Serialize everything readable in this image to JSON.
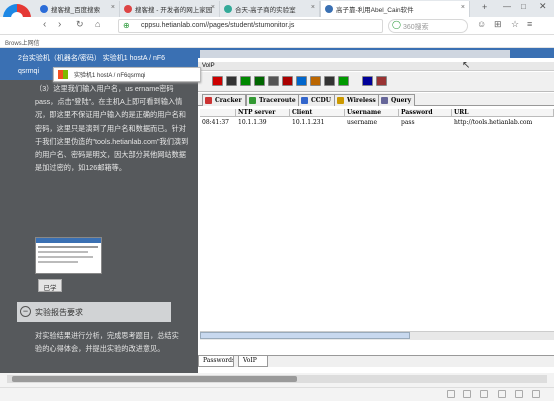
{
  "browser": {
    "tabs": [
      {
        "title": "搜客搜_百度搜索",
        "color": "#2b6cd8",
        "active": false
      },
      {
        "title": "搜客搜 - 开发者的网上家园",
        "color": "#d44",
        "active": false
      },
      {
        "title": "合天-高子商的实验室",
        "color": "#3a9",
        "active": false
      },
      {
        "title": "高子靠-利用Abel_Cain软件",
        "color": "#3a70b3",
        "active": true
      }
    ],
    "url": "cppsu.hetianlab.com//pages/student/stumonitor.js",
    "search_placeholder": "360搜索",
    "bookmark": "Brows上网信"
  },
  "left": {
    "header_line1": "2台实验机（机器名/密码）  实验机1  hostA / nF6",
    "header_line2": "qsrmqi",
    "paragraph": "（3）这里我们输入用户名，us ername密码pass，点击\"登陆\"。在主机A上即可看到输入情况，即这里不保证用户输入的是正确的用户名和密码，这里只是演到了用户名和数据而已。针对于我们这里伪造的\"tools.hetianlab.com\"我们演到的用户名、密码是明文，因大部分其他网站数据是加过密的，如126邮箱等。",
    "thumb_button": "已学",
    "section_title": "实验报告要求",
    "section_body": "对实验结果进行分析，完成思考题目，总结实验的心得体会，并提出实验的改进意见。"
  },
  "remote": {
    "tooltip": "实验机1    hostA / nF6qsrmqi",
    "voip_label": "VoIP",
    "subtabs": [
      {
        "label": "Cracker",
        "color": "#c33"
      },
      {
        "label": "Traceroute",
        "color": "#393"
      },
      {
        "label": "CCDU",
        "color": "#36c"
      },
      {
        "label": "Wireless",
        "color": "#c90"
      },
      {
        "label": "Query",
        "color": "#669"
      }
    ],
    "columns": [
      "",
      "NTP server",
      "Client",
      "Username",
      "Password",
      "URL"
    ],
    "rows": [
      [
        "08:41:37",
        "10.1.1.39",
        "10.1.1.231",
        "username",
        "pass",
        "http://tools.hetianlab.com"
      ]
    ],
    "bottom_tabs": [
      "Passwords",
      "VoIP"
    ]
  }
}
